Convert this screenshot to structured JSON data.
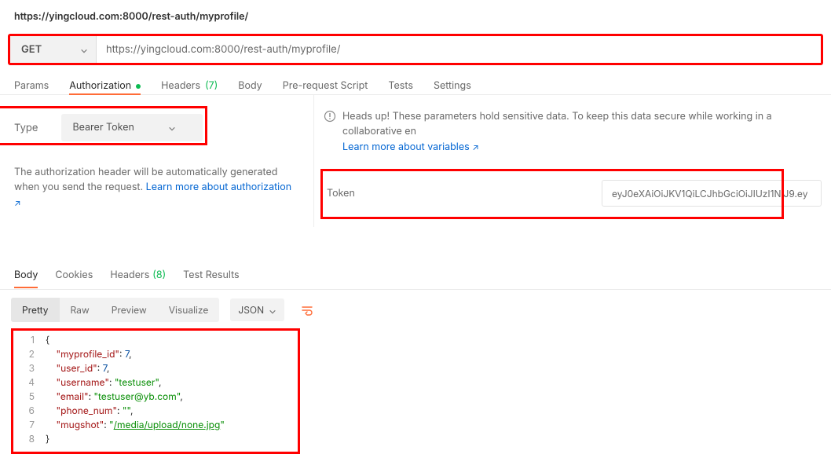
{
  "title": "https://yingcloud.com:8000/rest-auth/myprofile/",
  "request": {
    "method": "GET",
    "url": "https://yingcloud.com:8000/rest-auth/myprofile/"
  },
  "reqTabs": {
    "params": "Params",
    "authorization": "Authorization",
    "headers": "Headers",
    "headersCount": "(7)",
    "body": "Body",
    "prerequest": "Pre-request Script",
    "tests": "Tests",
    "settings": "Settings"
  },
  "auth": {
    "typeLabel": "Type",
    "typeValue": "Bearer Token",
    "autoNote_a": "The authorization header will be automatically generated when you send the request. ",
    "autoNote_link": "Learn more about authorization",
    "alert_a": "Heads up! These parameters hold sensitive data. To keep this data secure while working in a collaborative en",
    "alert_link": "Learn more about variables",
    "tokenLabel": "Token",
    "tokenValue": "eyJ0eXAiOiJKV1QiLCJhbGciOiJIUzI1NiJ9.ey"
  },
  "respTabs": {
    "body": "Body",
    "cookies": "Cookies",
    "headers": "Headers",
    "headersCount": "(8)",
    "tests": "Test Results"
  },
  "fmt": {
    "pretty": "Pretty",
    "raw": "Raw",
    "preview": "Preview",
    "visualize": "Visualize",
    "lang": "JSON"
  },
  "json": {
    "l1_open": "{",
    "l2_key": "\"myprofile_id\"",
    "l2_val": "7",
    "l3_key": "\"user_id\"",
    "l3_val": "7",
    "l4_key": "\"username\"",
    "l4_val": "\"testuser\"",
    "l5_key": "\"email\"",
    "l5_val": "\"testuser@yb.com\"",
    "l6_key": "\"phone_num\"",
    "l6_val": "\"\"",
    "l7_key": "\"mugshot\"",
    "l7_val": "\"/media/upload/none.jpg\"",
    "l8_close": "}"
  }
}
